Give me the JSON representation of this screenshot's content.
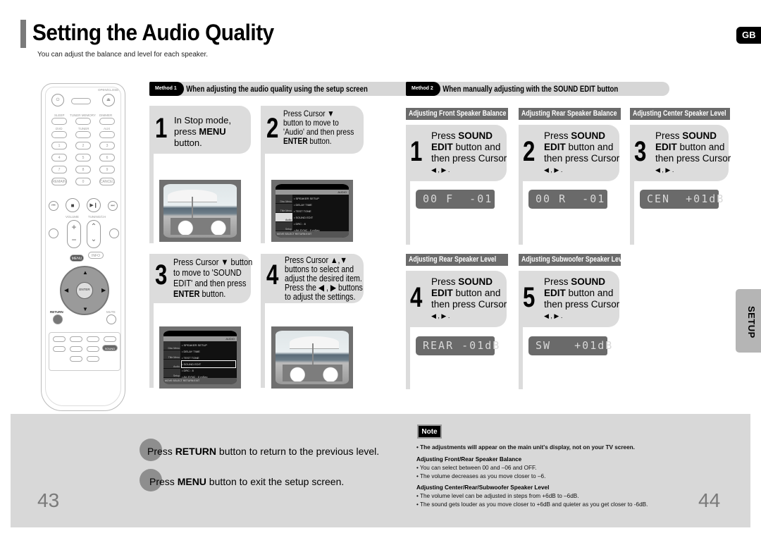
{
  "header": {
    "title": "Setting the Audio Quality",
    "subtitle": "You can adjust the balance and level for each speaker.",
    "language_tab": "GB",
    "section_tab": "SETUP"
  },
  "remote": {
    "buttons": [
      "OPEN/CLOSE",
      "SLEEP",
      "TUNER MEMORY",
      "DIMMER",
      "DVD",
      "TUNER",
      "AUX",
      "1",
      "2",
      "3",
      "4",
      "5",
      "6",
      "7",
      "8",
      "9",
      "REMAIN",
      "0",
      "CANCEL",
      "VOLUME",
      "TUNING/CH",
      "MENU",
      "INFO",
      "ENTER",
      "RETURN",
      "MUTE",
      "SOUND EDIT"
    ]
  },
  "method1": {
    "badge": "Method 1",
    "title": "When adjusting the audio quality using the setup screen",
    "steps": [
      {
        "num": "1",
        "lines": [
          "In Stop mode,",
          "press ",
          "button."
        ],
        "bold": "MENU"
      },
      {
        "num": "2",
        "lines": [
          "Press Cursor ▼",
          "button to move to",
          "'Audio' and then press",
          " button."
        ],
        "bold": "ENTER"
      },
      {
        "num": "3",
        "lines": [
          "Press Cursor ▼ button",
          "to move to 'SOUND",
          "EDIT' and then press",
          " button."
        ],
        "bold": "ENTER"
      },
      {
        "num": "4",
        "lines": [
          "Press Cursor  ▲,▼",
          "buttons to select and",
          "adjust the desired item.",
          "Press the  ◀ , ▶  buttons",
          "to adjust the settings."
        ]
      }
    ],
    "menu_screen": {
      "tab": "AUDIO",
      "side_items": [
        "Disc Menu",
        "Title Menu",
        "Audio",
        "Setup"
      ],
      "rows": [
        "• SPEAKER SETUP",
        "• DELAY TIME",
        "• TEST TONE",
        "• SOUND EDIT",
        "• DRC      : 8",
        "• AV-SYNC   : 0 mSec"
      ],
      "footer": "MOVE   SELECT   RETURN   EXIT"
    }
  },
  "method2": {
    "badge": "Method 2",
    "title": "When manually adjusting with the SOUND EDIT button",
    "steps": [
      {
        "num": "1",
        "category": "Adjusting Front Speaker Balance",
        "display": "00 F  -01"
      },
      {
        "num": "2",
        "category": "Adjusting Rear Speaker Balance",
        "display": "00 R  -01"
      },
      {
        "num": "3",
        "category": "Adjusting Center Speaker Level",
        "display": "CEN  +01dB"
      },
      {
        "num": "4",
        "category": "Adjusting Rear Speaker Level",
        "display": "REAR -01dB"
      },
      {
        "num": "5",
        "category": "Adjusting Subwoofer Speaker Level",
        "display": "SW   +01dB"
      }
    ],
    "step_text": {
      "press": "Press ",
      "sound": "SOUND",
      "edit": "EDIT",
      "line2": " button and",
      "line3": "then press Cursor",
      "arrows": "◀ , ▶ ."
    }
  },
  "tips": [
    {
      "prefix": "Press ",
      "bold": "RETURN",
      "suffix": " button to return to the previous level."
    },
    {
      "prefix": "Press ",
      "bold": "MENU",
      "suffix": " button to exit the setup screen."
    }
  ],
  "note": {
    "label": "Note",
    "main": "• The adjustments will appear on the main unit's display, not on your TV screen.",
    "sections": [
      {
        "heading": "Adjusting Front/Rear Speaker Balance",
        "items": [
          "•  You can select between 00 and –06 and OFF.",
          "•  The volume decreases as you move closer to –6."
        ]
      },
      {
        "heading": "Adjusting Center/Rear/Subwoofer Speaker Level",
        "items": [
          "•  The volume level can be adjusted in steps from +6dB to –6dB.",
          "•  The sound gets louder as you move closer to +6dB and quieter as you get closer to -6dB."
        ]
      }
    ]
  },
  "page_numbers": {
    "left": "43",
    "right": "44"
  }
}
